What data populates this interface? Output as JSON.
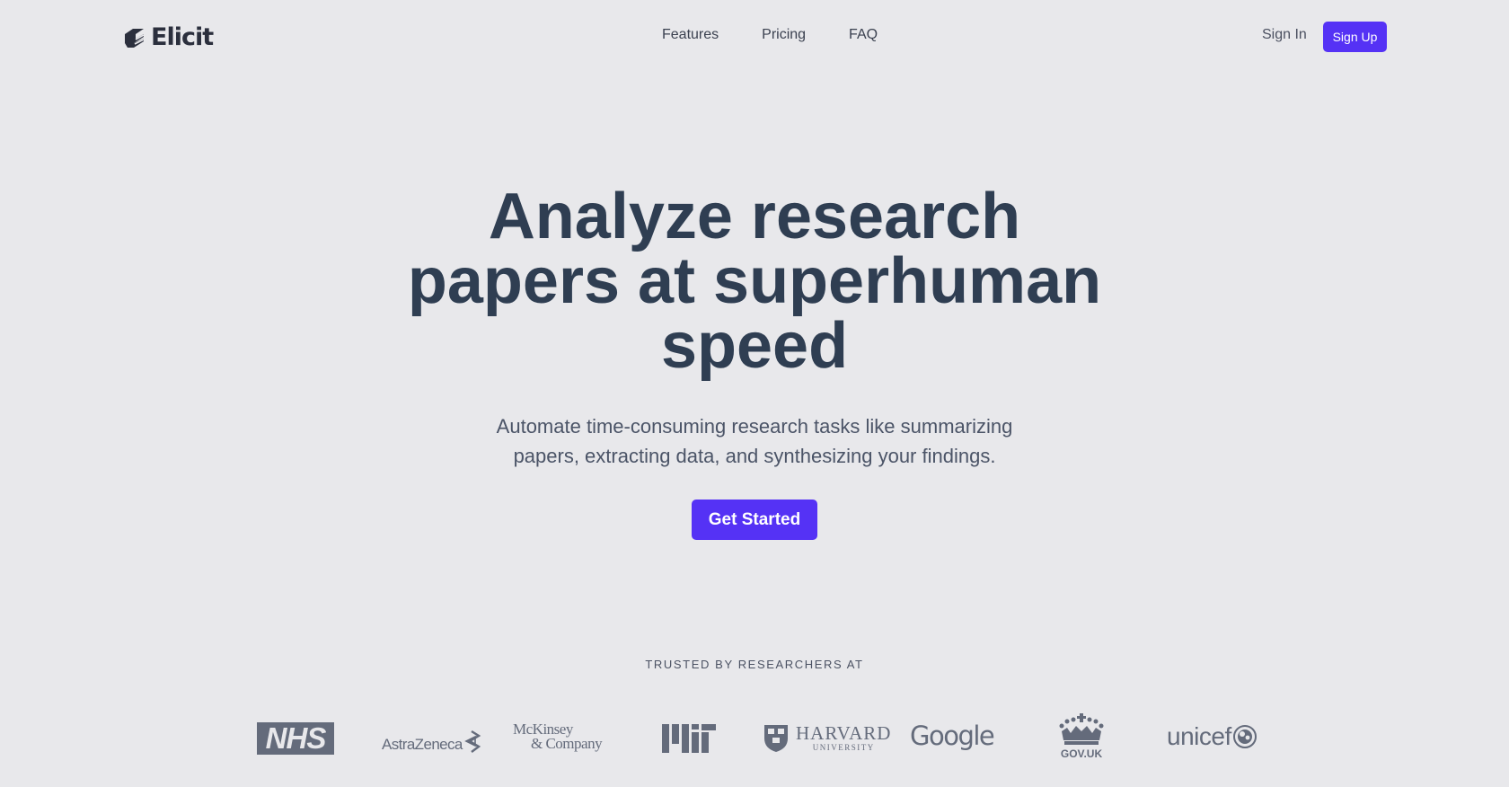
{
  "nav": {
    "logo_text": "Elicit",
    "links": [
      {
        "label": "Features"
      },
      {
        "label": "Pricing"
      },
      {
        "label": "FAQ"
      }
    ],
    "sign_in": "Sign In",
    "sign_up": "Sign Up"
  },
  "hero": {
    "title": "Analyze research papers at superhuman speed",
    "subtitle": "Automate time-consuming research tasks like summarizing papers, extracting data, and synthesizing your findings.",
    "cta": "Get Started"
  },
  "trusted": {
    "label": "TRUSTED BY RESEARCHERS AT",
    "logos": [
      {
        "name": "NHS",
        "text": "NHS"
      },
      {
        "name": "AstraZeneca",
        "text": "AstraZeneca"
      },
      {
        "name": "McKinsey & Company",
        "line1": "McKinsey",
        "line2": "& Company"
      },
      {
        "name": "MIT",
        "text": "MIT"
      },
      {
        "name": "Harvard University",
        "line1": "HARVARD",
        "line2": "UNIVERSITY"
      },
      {
        "name": "Google",
        "text": "Google"
      },
      {
        "name": "GOV.UK",
        "text": "GOV.UK"
      },
      {
        "name": "unicef",
        "text": "unicef"
      }
    ]
  },
  "colors": {
    "background": "#e8e8eb",
    "accent": "#5532f5",
    "heading": "#2f3e52",
    "logo_gray": "#646b7b"
  }
}
